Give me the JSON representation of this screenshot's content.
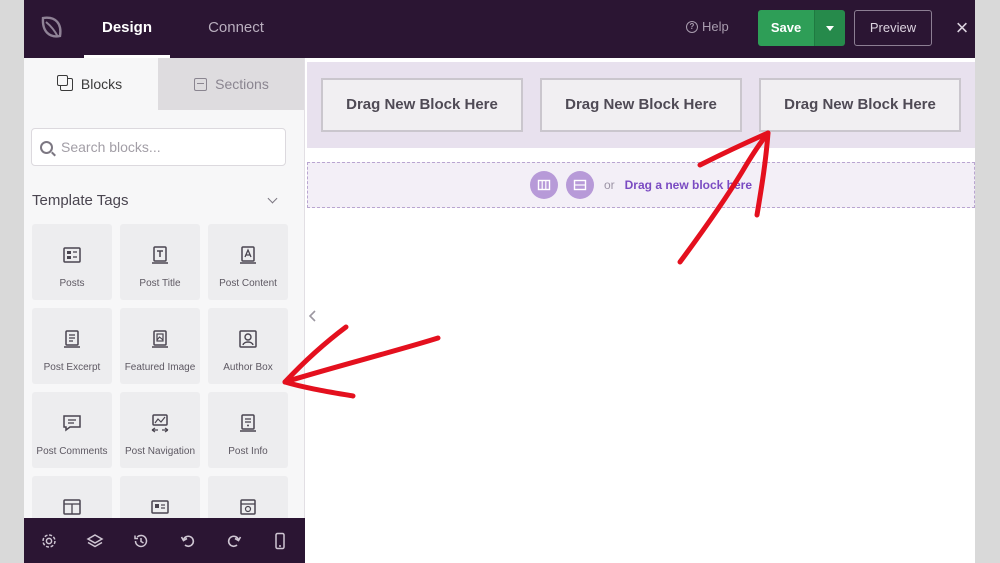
{
  "header": {
    "tabs": [
      {
        "label": "Design",
        "active": true
      },
      {
        "label": "Connect",
        "active": false
      }
    ],
    "help_label": "Help",
    "save_label": "Save",
    "preview_label": "Preview"
  },
  "sidebar": {
    "tabs": {
      "blocks": "Blocks",
      "sections": "Sections"
    },
    "search_placeholder": "Search blocks...",
    "group_title": "Template Tags",
    "tiles": [
      {
        "label": "Posts",
        "icon": "posts-icon"
      },
      {
        "label": "Post Title",
        "icon": "post-title-icon"
      },
      {
        "label": "Post Content",
        "icon": "post-content-icon"
      },
      {
        "label": "Post Excerpt",
        "icon": "post-excerpt-icon"
      },
      {
        "label": "Featured Image",
        "icon": "featured-image-icon"
      },
      {
        "label": "Author Box",
        "icon": "author-box-icon"
      },
      {
        "label": "Post Comments",
        "icon": "post-comments-icon"
      },
      {
        "label": "Post Navigation",
        "icon": "post-navigation-icon"
      },
      {
        "label": "Post Info",
        "icon": "post-info-icon"
      },
      {
        "label": "",
        "icon": "template-icon"
      },
      {
        "label": "",
        "icon": "id-card-icon"
      },
      {
        "label": "",
        "icon": "window-icon"
      }
    ]
  },
  "canvas": {
    "dropzones": [
      "Drag New Block Here",
      "Drag New Block Here",
      "Drag New Block Here"
    ],
    "section_or": "or",
    "section_link": "Drag a new block here"
  },
  "colors": {
    "topbar": "#2b1533",
    "save_green": "#2e9e57",
    "accent_purple": "#b79ad8",
    "annotation_red": "#e4101e"
  }
}
